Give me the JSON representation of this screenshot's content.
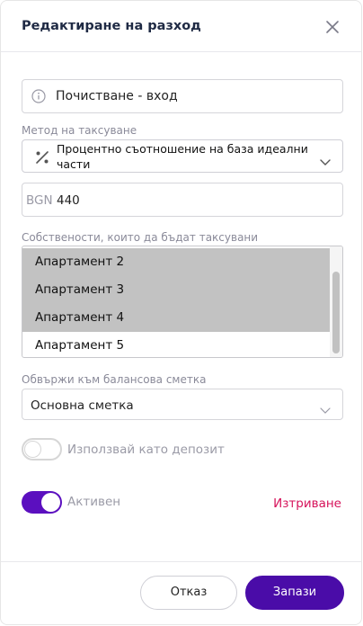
{
  "modal": {
    "title": "Редактиране на разход"
  },
  "description": {
    "value": "Почистване - вход"
  },
  "method": {
    "label": "Метод на таксуване",
    "value": "Процентно съотношение на база идеални части"
  },
  "amount": {
    "currency": "BGN",
    "value": "440"
  },
  "properties": {
    "label": "Собствености, които да бъдат таксувани",
    "items": [
      {
        "label": "Апартамент 2",
        "selected": true
      },
      {
        "label": "Апартамент 3",
        "selected": true
      },
      {
        "label": "Апартамент 4",
        "selected": true
      },
      {
        "label": "Апартамент 5",
        "selected": false
      }
    ]
  },
  "account": {
    "label": "Обвържи към балансова сметка",
    "value": "Основна сметка"
  },
  "deposit_toggle": {
    "label": "Използвай като депозит",
    "on": false
  },
  "active_toggle": {
    "label": "Активен",
    "on": true
  },
  "actions": {
    "delete_label": "Изтриване",
    "cancel_label": "Отказ",
    "save_label": "Запази"
  },
  "colors": {
    "primary": "#4a0ca8",
    "toggle_on": "#5b0fbf",
    "danger": "#d6135b",
    "selection": "#c2c2c2"
  }
}
